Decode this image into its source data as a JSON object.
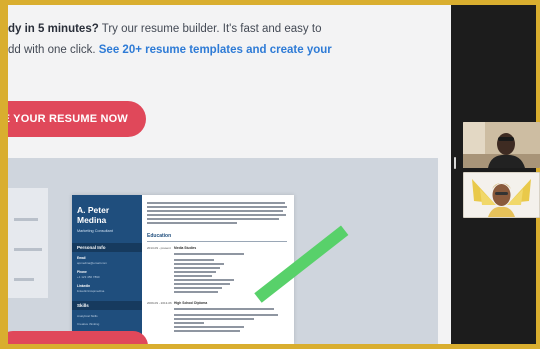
{
  "page": {
    "headline_bold": "dy in 5 minutes?",
    "headline_rest": " Try our resume builder. It's fast and easy to",
    "headline_line2": "dd with one click. ",
    "headline_link": "See 20+ resume templates and create your",
    "cta_label": "E YOUR RESUME NOW"
  },
  "resume": {
    "first_name": "A. Peter",
    "last_name": "Medina",
    "role": "Marketing Consultant",
    "personal_info": "Personal Info",
    "email_label": "Email",
    "email_value": "apmedina@email.com",
    "phone_label": "Phone",
    "phone_value": "+1 123 456 7890",
    "linkedin_label": "LinkedIn",
    "linkedin_value": "linkedin/in/apmedina",
    "skills_label": "Skills",
    "skill1": "Analytical Skills",
    "skill2": "Creative thinking",
    "education_label": "Education",
    "edu1_school": "Media Studies",
    "edu1_dates": "2013-09 - present",
    "edu2_school": "High School Diploma",
    "edu2_dates": "2009-09 - 2013-06"
  },
  "colors": {
    "frame": "#d9ae2f",
    "accent": "#e0485a",
    "link": "#2e7bd6",
    "resume_side": "#1f4e7d",
    "stripe": "#58d16a"
  },
  "participants": [
    {
      "icon": "person-video-icon"
    },
    {
      "icon": "avatar-illustration-icon"
    }
  ]
}
